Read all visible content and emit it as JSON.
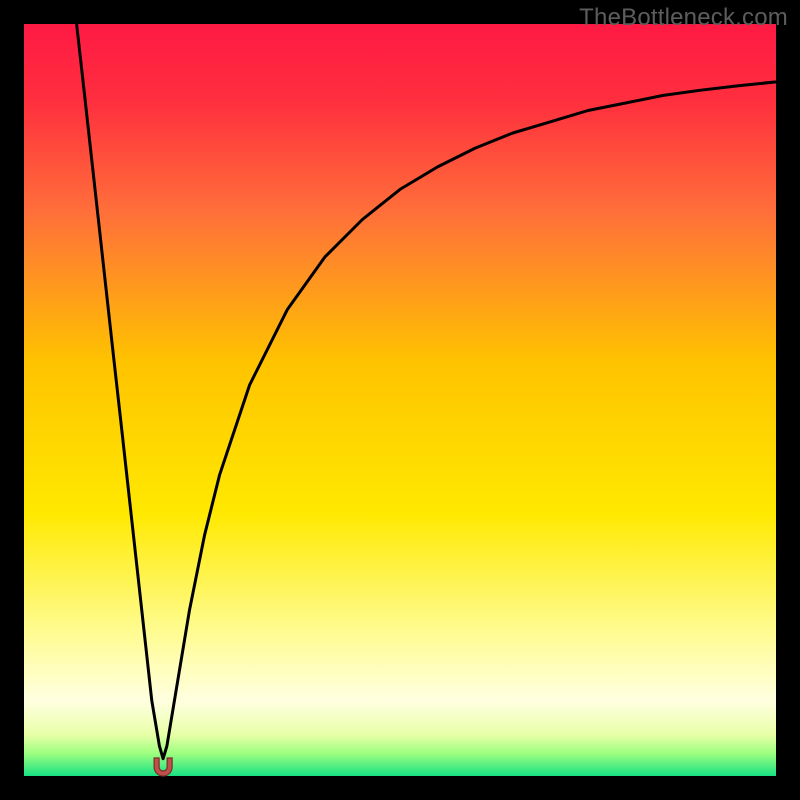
{
  "watermark": "TheBottleneck.com",
  "frame": {
    "outer_width": 800,
    "outer_height": 800,
    "border": 24,
    "border_color": "#000000"
  },
  "gradient": {
    "stops": [
      {
        "offset": 0.0,
        "color": "#ff1a44"
      },
      {
        "offset": 0.1,
        "color": "#ff2e3e"
      },
      {
        "offset": 0.25,
        "color": "#ff6f3a"
      },
      {
        "offset": 0.45,
        "color": "#ffc300"
      },
      {
        "offset": 0.65,
        "color": "#ffe900"
      },
      {
        "offset": 0.8,
        "color": "#fffb8a"
      },
      {
        "offset": 0.9,
        "color": "#ffffe0"
      },
      {
        "offset": 0.945,
        "color": "#e8ffa8"
      },
      {
        "offset": 0.97,
        "color": "#9dff80"
      },
      {
        "offset": 1.0,
        "color": "#17e183"
      }
    ]
  },
  "marker": {
    "color": "#c0514a",
    "stroke": "#7a2f2a"
  },
  "chart_data": {
    "type": "line",
    "title": "",
    "xlabel": "",
    "ylabel": "",
    "x_range": [
      0,
      100
    ],
    "y_range": [
      0,
      100
    ],
    "notch_x": 18.5,
    "series": [
      {
        "name": "curve",
        "x": [
          7,
          8,
          9,
          10,
          11,
          12,
          13,
          14,
          15,
          16,
          17,
          18,
          18.5,
          19,
          20,
          22,
          24,
          26,
          30,
          35,
          40,
          45,
          50,
          55,
          60,
          65,
          70,
          75,
          80,
          85,
          90,
          95,
          100
        ],
        "y": [
          100,
          91,
          82,
          73,
          64,
          55,
          46,
          37,
          28,
          19,
          10,
          4,
          2.3,
          4,
          10,
          22,
          32,
          40,
          52,
          62,
          69,
          74,
          78,
          81,
          83.5,
          85.5,
          87,
          88.5,
          89.5,
          90.5,
          91.2,
          91.8,
          92.3
        ]
      }
    ]
  }
}
